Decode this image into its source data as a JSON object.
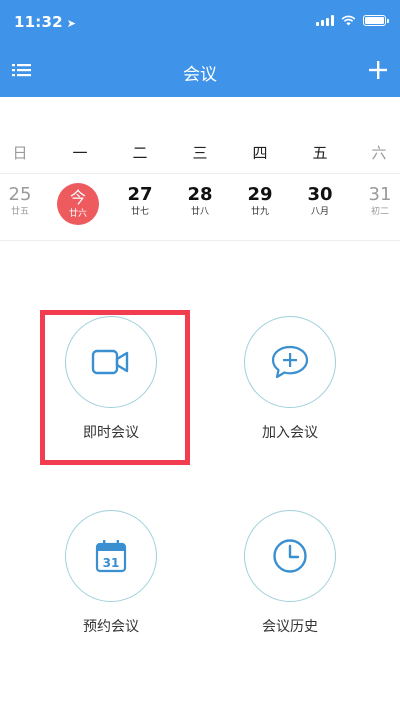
{
  "status_bar": {
    "time": "11:32",
    "location_icon": "location-arrow-icon",
    "signal_icon": "signal-icon",
    "wifi_icon": "wifi-icon",
    "battery_icon": "battery-icon"
  },
  "nav": {
    "title": "会议",
    "menu_icon": "list-menu-icon",
    "add_icon": "plus-icon",
    "background_color": "#3f93e8"
  },
  "calendar": {
    "weekdays": [
      "日",
      "一",
      "二",
      "三",
      "四",
      "五",
      "六"
    ],
    "dates": [
      {
        "day": "25",
        "lunar": "廿五"
      },
      {
        "day": "今",
        "lunar": "廿六"
      },
      {
        "day": "27",
        "lunar": "廿七"
      },
      {
        "day": "28",
        "lunar": "廿八"
      },
      {
        "day": "29",
        "lunar": "廿九"
      },
      {
        "day": "30",
        "lunar": "八月"
      },
      {
        "day": "31",
        "lunar": "初二"
      }
    ],
    "today_color": "#ee5b5e"
  },
  "actions": [
    {
      "label": "即时会议",
      "icon": "video-camera-icon"
    },
    {
      "label": "加入会议",
      "icon": "chat-bubble-plus-icon"
    },
    {
      "label": "预约会议",
      "icon": "calendar-31-icon",
      "icon_text": "31"
    },
    {
      "label": "会议历史",
      "icon": "clock-icon"
    }
  ],
  "colors": {
    "icon_stroke": "#3a8fd0",
    "circle_border": "#9fd0da",
    "highlight_border": "#f23c4f"
  }
}
